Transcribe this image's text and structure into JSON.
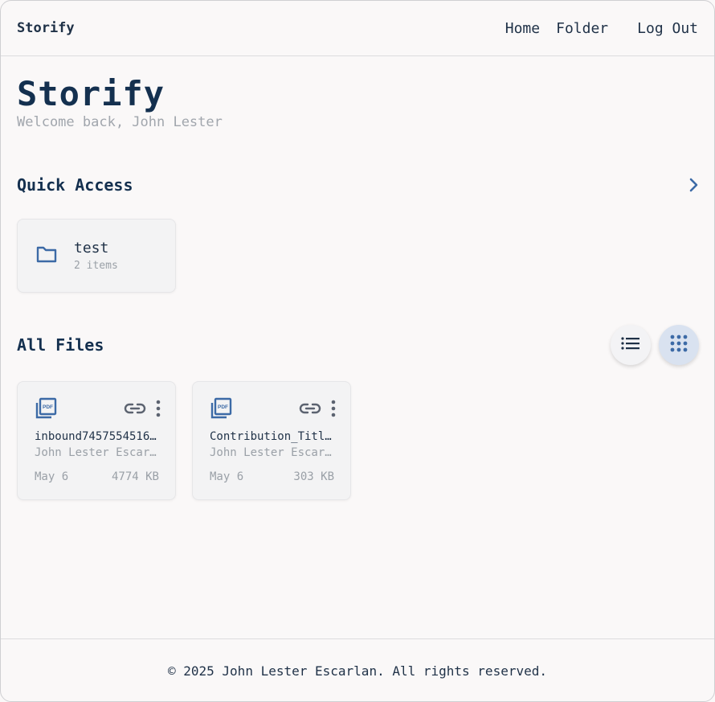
{
  "header": {
    "brand": "Storify",
    "nav": {
      "home": "Home",
      "folder": "Folder",
      "logout": "Log Out"
    }
  },
  "main": {
    "title": "Storify",
    "welcome": "Welcome back, John Lester"
  },
  "quick_access": {
    "title": "Quick Access",
    "folders": [
      {
        "name": "test",
        "count": "2 items",
        "icon": "folder-icon"
      }
    ]
  },
  "all_files": {
    "title": "All Files",
    "view_modes": [
      "list-icon",
      "grid-icon"
    ],
    "active_view": "grid",
    "files": [
      {
        "name": "inbound7457554516…",
        "owner": "John Lester Escar…",
        "date": "May 6",
        "size": "4774 KB",
        "icon": "pdf-icon"
      },
      {
        "name": "Contribution_Titl…",
        "owner": "John Lester Escar…",
        "date": "May 6",
        "size": "303 KB",
        "icon": "pdf-icon"
      }
    ]
  },
  "footer": {
    "text": "© 2025 John Lester Escarlan. All rights reserved."
  },
  "colors": {
    "accent": "#3c6aa6",
    "title": "#14304f",
    "muted": "#9aa0a7",
    "background": "#faf8f8"
  }
}
